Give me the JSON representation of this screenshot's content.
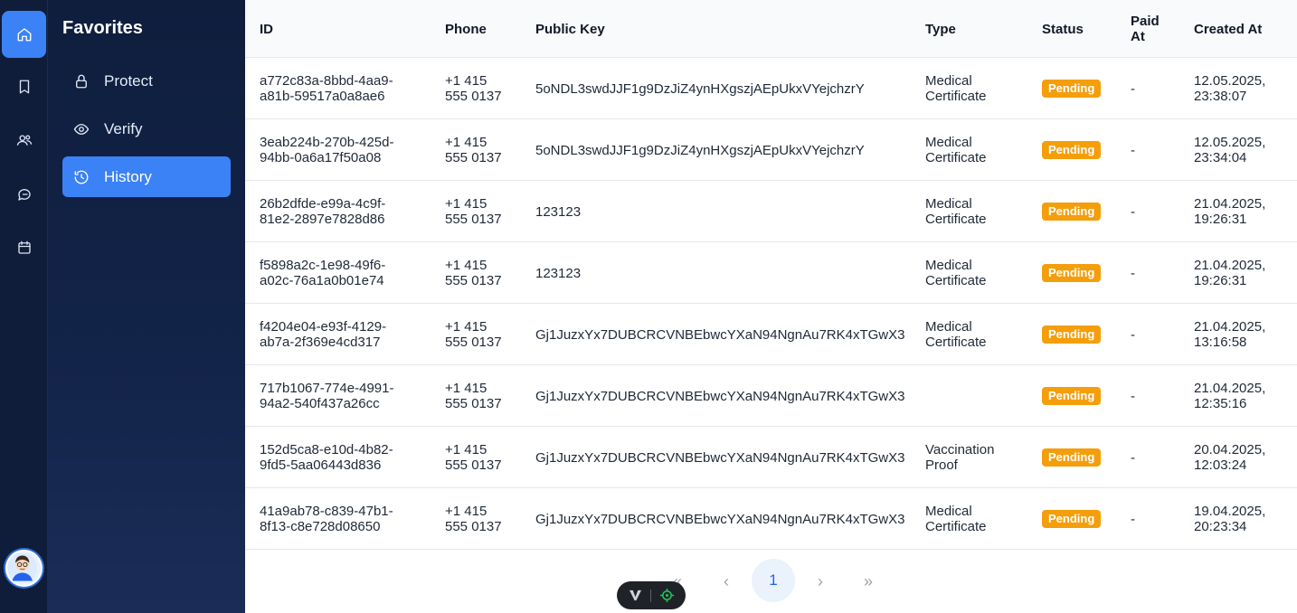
{
  "sidebar": {
    "title": "Favorites",
    "items": [
      {
        "label": "Protect",
        "icon": "lock-icon"
      },
      {
        "label": "Verify",
        "icon": "eye-icon"
      },
      {
        "label": "History",
        "icon": "history-icon"
      }
    ]
  },
  "rail": [
    "home-icon",
    "bookmark-icon",
    "users-icon",
    "chat-icon",
    "calendar-icon"
  ],
  "table": {
    "headers": {
      "id": "ID",
      "phone": "Phone",
      "key": "Public Key",
      "type": "Type",
      "status": "Status",
      "paid_a": "Paid",
      "paid_b": "At",
      "created": "Created At"
    },
    "rows": [
      {
        "id1": "a772c83a-8bbd-4aa9-",
        "id2": "a81b-59517a0a8ae6",
        "ph1": "+1 415",
        "ph2": "555 0137",
        "key": "5oNDL3swdJJF1g9DzJiZ4ynHXgszjAEpUkxVYejchzrY",
        "t1": "Medical",
        "t2": "Certificate",
        "status": "Pending",
        "paid": "-",
        "cr1": "12.05.2025,",
        "cr2": "23:38:07"
      },
      {
        "id1": "3eab224b-270b-425d-",
        "id2": "94bb-0a6a17f50a08",
        "ph1": "+1 415",
        "ph2": "555 0137",
        "key": "5oNDL3swdJJF1g9DzJiZ4ynHXgszjAEpUkxVYejchzrY",
        "t1": "Medical",
        "t2": "Certificate",
        "status": "Pending",
        "paid": "-",
        "cr1": "12.05.2025,",
        "cr2": "23:34:04"
      },
      {
        "id1": "26b2dfde-e99a-4c9f-",
        "id2": "81e2-2897e7828d86",
        "ph1": "+1 415",
        "ph2": "555 0137",
        "key": "123123",
        "t1": "Medical",
        "t2": "Certificate",
        "status": "Pending",
        "paid": "-",
        "cr1": "21.04.2025,",
        "cr2": "19:26:31"
      },
      {
        "id1": "f5898a2c-1e98-49f6-",
        "id2": "a02c-76a1a0b01e74",
        "ph1": "+1 415",
        "ph2": "555 0137",
        "key": "123123",
        "t1": "Medical",
        "t2": "Certificate",
        "status": "Pending",
        "paid": "-",
        "cr1": "21.04.2025,",
        "cr2": "19:26:31"
      },
      {
        "id1": "f4204e04-e93f-4129-",
        "id2": "ab7a-2f369e4cd317",
        "ph1": "+1 415",
        "ph2": "555 0137",
        "key": "Gj1JuzxYx7DUBCRCVNBEbwcYXaN94NgnAu7RK4xTGwX3",
        "t1": "Medical",
        "t2": "Certificate",
        "status": "Pending",
        "paid": "-",
        "cr1": "21.04.2025,",
        "cr2": "13:16:58"
      },
      {
        "id1": "717b1067-774e-4991-",
        "id2": "94a2-540f437a26cc",
        "ph1": "+1 415",
        "ph2": "555 0137",
        "key": "Gj1JuzxYx7DUBCRCVNBEbwcYXaN94NgnAu7RK4xTGwX3",
        "t1": "",
        "t2": "",
        "status": "Pending",
        "paid": "-",
        "cr1": "21.04.2025,",
        "cr2": "12:35:16"
      },
      {
        "id1": "152d5ca8-e10d-4b82-",
        "id2": "9fd5-5aa06443d836",
        "ph1": "+1 415",
        "ph2": "555 0137",
        "key": "Gj1JuzxYx7DUBCRCVNBEbwcYXaN94NgnAu7RK4xTGwX3",
        "t1": "Vaccination",
        "t2": "Proof",
        "status": "Pending",
        "paid": "-",
        "cr1": "20.04.2025,",
        "cr2": "12:03:24"
      },
      {
        "id1": "41a9ab78-c839-47b1-",
        "id2": "8f13-c8e728d08650",
        "ph1": "+1 415",
        "ph2": "555 0137",
        "key": "Gj1JuzxYx7DUBCRCVNBEbwcYXaN94NgnAu7RK4xTGwX3",
        "t1": "Medical",
        "t2": "Certificate",
        "status": "Pending",
        "paid": "-",
        "cr1": "19.04.2025,",
        "cr2": "20:23:34"
      }
    ]
  },
  "pagination": {
    "first": "«",
    "prev": "‹",
    "current": "1",
    "next": "›",
    "last": "»"
  },
  "colors": {
    "accent": "#3b82f6",
    "pending": "#f59e0b",
    "sidebar": "#0f1e3d"
  }
}
